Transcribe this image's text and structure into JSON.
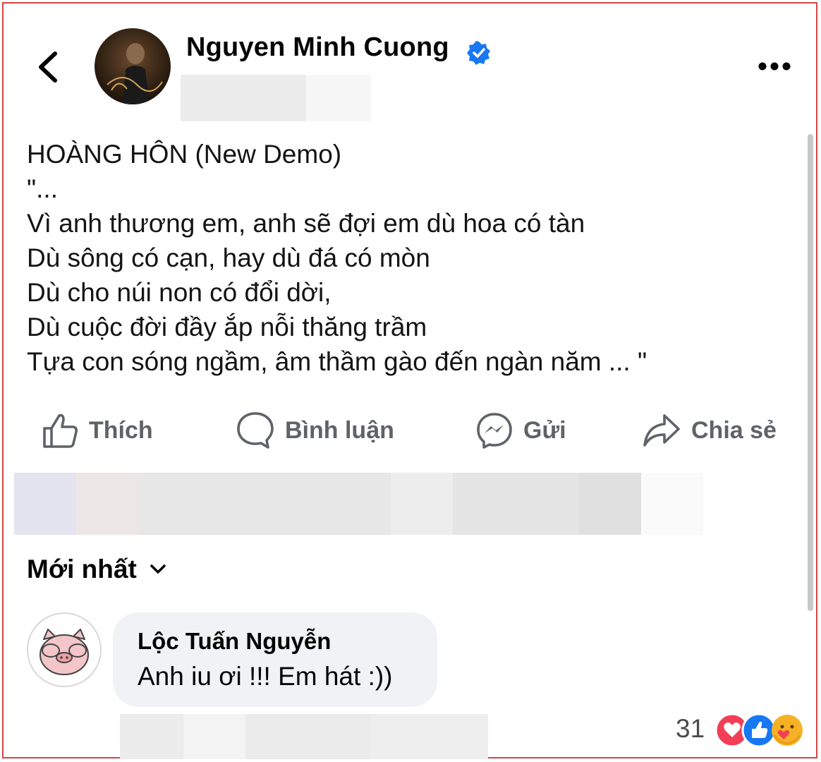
{
  "header": {
    "back_icon": "chevron-left-icon",
    "author_name": "Nguyen Minh Cuong",
    "verified_icon": "verified-badge-icon",
    "more_icon": "more-horizontal-icon"
  },
  "post": {
    "lines": [
      "HOÀNG HÔN (New Demo)",
      "\"...",
      "Vì anh thương em, anh sẽ đợi em dù hoa có tàn",
      "Dù sông có cạn, hay dù đá có mòn",
      "Dù cho núi non có đổi dời,",
      "Dù cuộc đời đầy ắp nỗi thăng trầm",
      "Tựa con sóng ngầm, âm thầm gào đến ngàn năm ... \""
    ]
  },
  "actions": [
    {
      "label": "Thích",
      "icon": "like-icon"
    },
    {
      "label": "Bình luận",
      "icon": "comment-icon"
    },
    {
      "label": "Gửi",
      "icon": "messenger-icon"
    },
    {
      "label": "Chia sẻ",
      "icon": "share-icon"
    }
  ],
  "comments": {
    "sort_label": "Mới nhất",
    "items": [
      {
        "author": "Lộc Tuấn Nguyễn",
        "text": "Anh iu ơi !!! Em hát :))",
        "reaction_count": "31"
      }
    ]
  },
  "colors": {
    "accent": "#1877f2",
    "text": "#050505",
    "muted": "#5f6368",
    "bubble": "#f0f2f5",
    "frame": "#d64545",
    "love": "#f33e58"
  }
}
